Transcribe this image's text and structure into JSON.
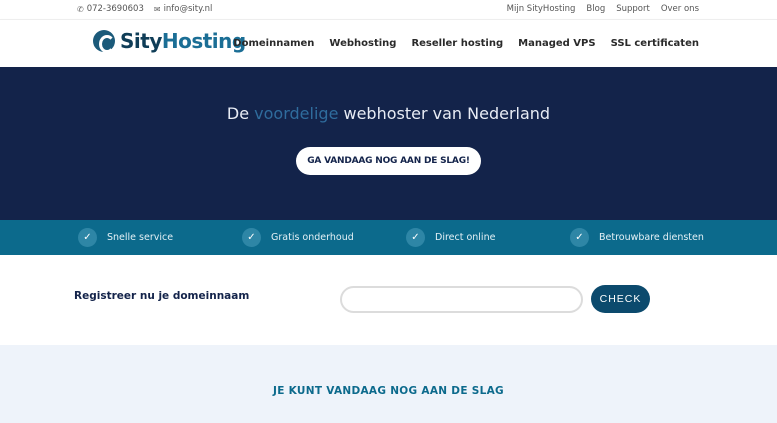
{
  "topbar": {
    "phone_icon": "phone-icon",
    "phone": "072-3690603",
    "email_icon": "envelope-icon",
    "email": "info@sity.nl",
    "links": [
      "Mijn SityHosting",
      "Blog",
      "Support",
      "Over ons"
    ]
  },
  "header": {
    "logo_part1": "Sity",
    "logo_part2": "Hosting",
    "nav": [
      "Domeinnamen",
      "Webhosting",
      "Reseller hosting",
      "Managed VPS",
      "SSL certificaten"
    ]
  },
  "hero": {
    "title_prefix": "De",
    "title_highlight": "voordelige",
    "title_suffix": "webhoster van Nederland",
    "button": "GA VANDAAG NOG AAN DE SLAG!"
  },
  "features": [
    {
      "icon": "check-icon",
      "label": "Snelle service"
    },
    {
      "icon": "check-icon",
      "label": "Gratis onderhoud"
    },
    {
      "icon": "check-icon",
      "label": "Direct online"
    },
    {
      "icon": "check-icon",
      "label": "Betrouwbare diensten"
    }
  ],
  "domain": {
    "label": "Registreer nu je domeinnaam",
    "input_value": "",
    "button": "CHECK"
  },
  "cta": {
    "heading": "JE KUNT VANDAAG NOG AAN DE SLAG"
  },
  "colors": {
    "hero_bg": "#13234a",
    "features_bg": "#0c6a8c",
    "accent": "#0c4a6d",
    "cta_bg": "#eef3fa"
  }
}
